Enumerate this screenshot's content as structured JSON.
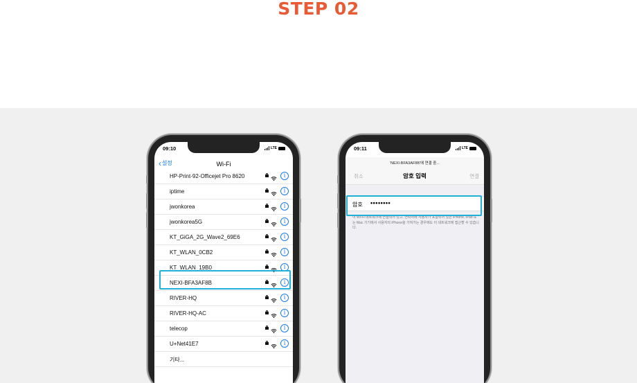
{
  "header": {
    "step_label": "STEP 02",
    "accent_color": "#e95b35"
  },
  "left_phone": {
    "status_time": "09:10",
    "status_network": "LTE",
    "back_label": "설정",
    "title": "Wi-Fi",
    "networks": [
      {
        "name": "HP-Print-92-Officejet Pro 8620"
      },
      {
        "name": "iptime"
      },
      {
        "name": "jwonkorea"
      },
      {
        "name": "jwonkorea5G"
      },
      {
        "name": "KT_GiGA_2G_Wave2_69E6"
      },
      {
        "name": "KT_WLAN_0CB2"
      },
      {
        "name": "KT_WLAN_19B0"
      },
      {
        "name": "NEXI-BFA3AF8B",
        "highlighted": true
      },
      {
        "name": "RIVER-HQ"
      },
      {
        "name": "RIVER-HQ-AC"
      },
      {
        "name": "telecop"
      },
      {
        "name": "U+Net41E7"
      }
    ],
    "other_label": "기타...",
    "highlight_color": "#1fb0d8"
  },
  "right_phone": {
    "status_time": "09:11",
    "status_network": "LTE",
    "subtitle": "'NEXI-BFA3AF8B'에 연결 중...",
    "cancel_label": "취소",
    "title": "암호 입력",
    "join_label": "연결",
    "password_label": "암호",
    "password_value": "••••••••",
    "note": "이 Wi-Fi 네트워크에 연결되어 있고, 연락처에 사용자가 포함되어 있는 iPhone, iPad 또는 Mac 기기에서 사용자의 iPhone을 가져가는 경우에도 이 네트워크에 접근할 수 있습니다."
  }
}
